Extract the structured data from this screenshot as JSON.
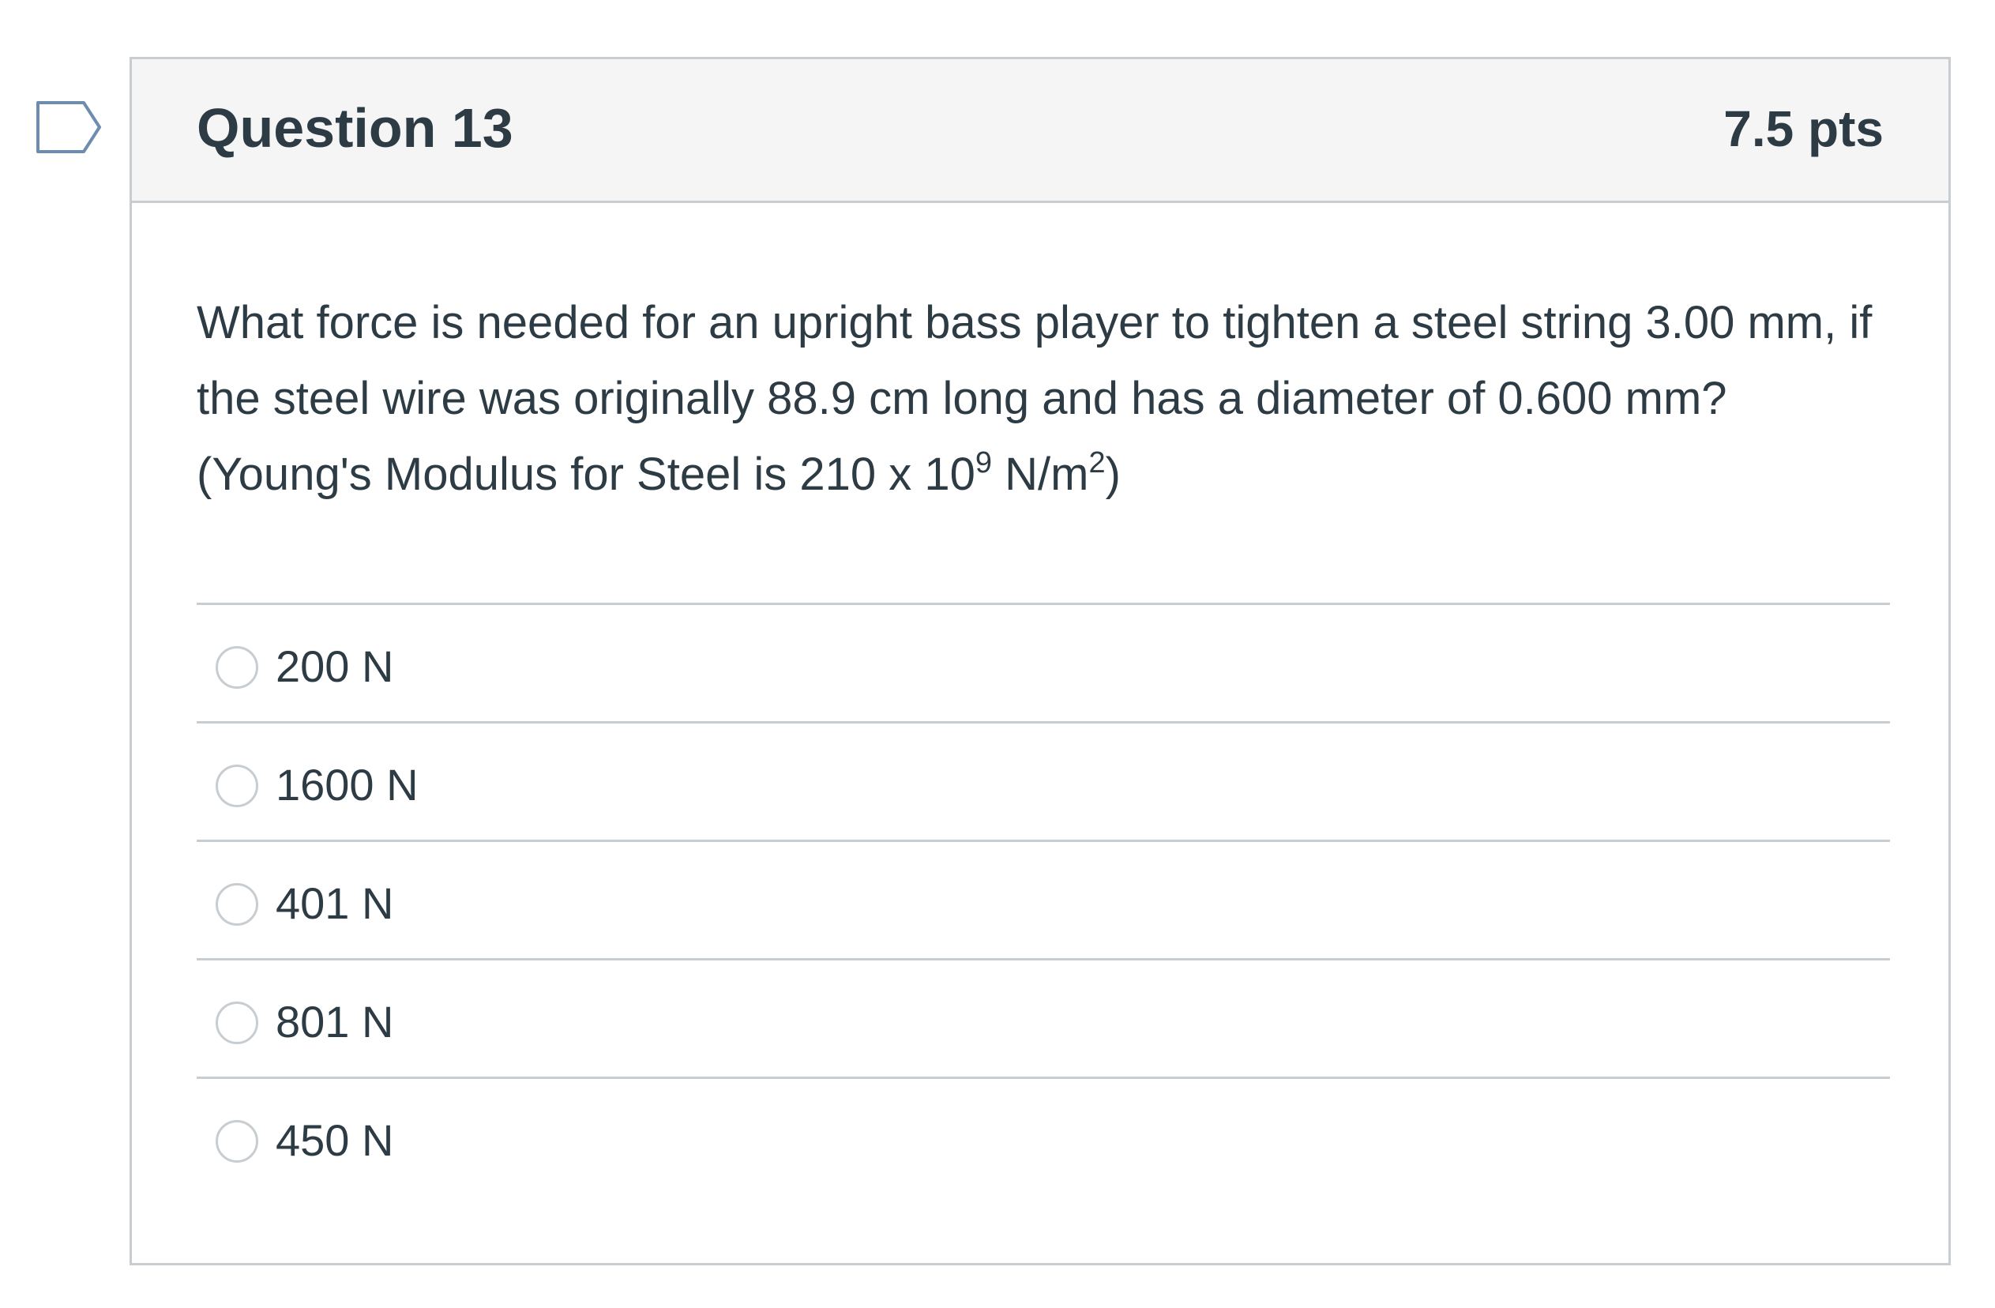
{
  "question": {
    "title": "Question 13",
    "points": "7.5 pts",
    "text_main": "What force is needed for an upright bass player to tighten a steel string 3.00 mm, if the steel wire was originally 88.9 cm long and has a diameter of 0.600 mm? (Young's Modulus for Steel is 210 x 10",
    "text_exp": "9",
    "text_mid": " N/m",
    "text_sq": "2",
    "text_end": ")"
  },
  "answers": [
    {
      "label": "200 N",
      "selected": false
    },
    {
      "label": "1600 N",
      "selected": false
    },
    {
      "label": "401 N",
      "selected": false
    },
    {
      "label": "801 N",
      "selected": false
    },
    {
      "label": "450 N",
      "selected": false
    }
  ],
  "icons": {
    "flag": "flag-icon"
  },
  "colors": {
    "text": "#2d3b45",
    "border": "#c7cdd1",
    "header_bg": "#f5f5f5",
    "flag": "#6e8cae"
  }
}
